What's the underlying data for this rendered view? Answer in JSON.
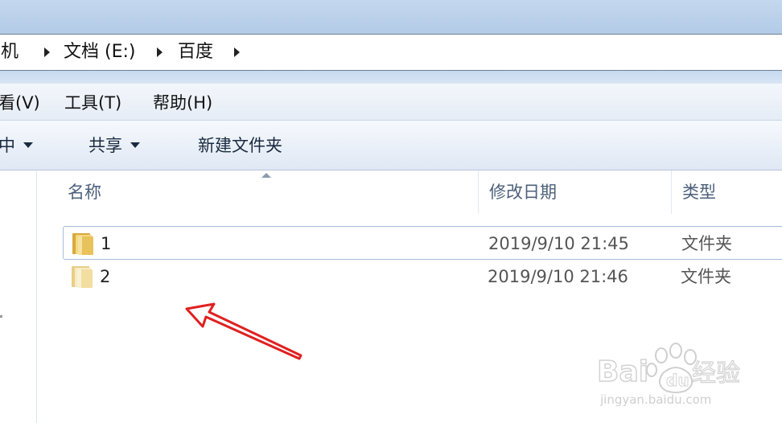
{
  "address_bar": {
    "crumbs": [
      "机",
      "文档 (E:)",
      "百度"
    ]
  },
  "menu": {
    "items": [
      "看(V)",
      "工具(T)",
      "帮助(H)"
    ]
  },
  "toolbar": {
    "include_label": "中",
    "share_label": "共享",
    "new_folder_label": "新建文件夹"
  },
  "columns": {
    "name": "名称",
    "date": "修改日期",
    "type": "类型"
  },
  "files": [
    {
      "name": "1",
      "modified": "2019/9/10 21:45",
      "type": "文件夹"
    },
    {
      "name": "2",
      "modified": "2019/9/10 21:46",
      "type": "文件夹"
    }
  ],
  "colors": {
    "annotation": "#e02020",
    "folder": "#e8c25a"
  },
  "watermark": {
    "brand": "Bai",
    "brand_du": "du",
    "brand_cn": "经验",
    "url": "jingyan.baidu.com"
  },
  "icons": [
    "folder-icon",
    "chevron-right-icon",
    "dropdown-arrow-icon",
    "red-arrow-annotation",
    "paw-icon"
  ]
}
